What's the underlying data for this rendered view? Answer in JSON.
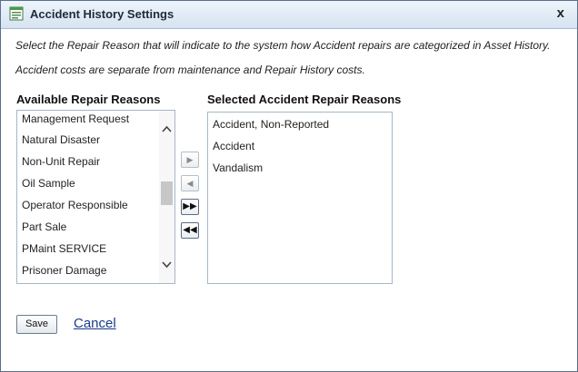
{
  "dialog": {
    "title": "Accident History Settings",
    "close_label": "x"
  },
  "instructions": [
    "Select the Repair Reason that will indicate to the system how Accident repairs are categorized in Asset History.",
    "Accident costs are separate from maintenance and Repair History costs."
  ],
  "available": {
    "heading": "Available Repair Reasons",
    "items": [
      "Management Request",
      "Natural Disaster",
      "Non-Unit Repair",
      "Oil Sample",
      "Operator Responsible",
      "Part Sale",
      "PMaint SERVICE",
      "Prisoner Damage"
    ]
  },
  "selected": {
    "heading": "Selected Accident Repair Reasons",
    "items": [
      "Accident, Non-Reported",
      "Accident",
      "Vandalism"
    ]
  },
  "move_buttons": {
    "add": "▶",
    "remove": "◀",
    "add_all": "▶▶",
    "remove_all": "◀◀"
  },
  "actions": {
    "save_label": "Save",
    "cancel_label": "Cancel"
  },
  "colors": {
    "titlebar": "#d6e3f1",
    "link": "#1a3a8c",
    "border": "#a7b6c6"
  }
}
